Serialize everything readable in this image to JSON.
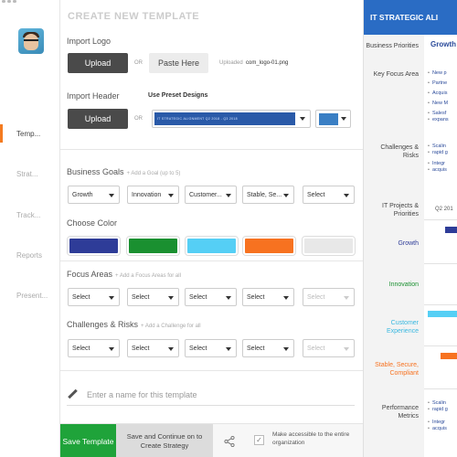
{
  "sidebar": {
    "items": [
      {
        "label": "Temp..."
      },
      {
        "label": "Strat..."
      },
      {
        "label": "Track..."
      },
      {
        "label": "Reports"
      },
      {
        "label": "Present..."
      }
    ]
  },
  "panel": {
    "title": "CREATE NEW TEMPLATE",
    "import_logo": {
      "label": "Import Logo",
      "upload": "Upload",
      "or": "OR",
      "paste": "Paste Here",
      "uploaded_label": "Uploaded",
      "uploaded_file": "com_logo-01.png"
    },
    "import_header": {
      "label": "Import Header",
      "upload": "Upload",
      "or": "OR",
      "preset_label": "Use Preset Designs",
      "preset_strip_text": "IT STRATEGIC ALIGNMENT   Q2 2018 - Q3 2018",
      "color_value": "#3a7fc4"
    },
    "business_goals": {
      "label": "Business Goals",
      "hint": "+ Add a Goal (up to 5)",
      "selects": [
        "Growth",
        "Innovation",
        "Customer...",
        "Stable, Se...",
        "Select"
      ]
    },
    "choose_color": {
      "label": "Choose Color",
      "colors": [
        "#2e3c98",
        "#1a9030",
        "#55cff5",
        "#f77220",
        "#e8e8e8"
      ]
    },
    "focus_areas": {
      "label": "Focus Areas",
      "hint": "+ Add a Focus Areas for all",
      "selects": [
        "Select",
        "Select",
        "Select",
        "Select",
        "Select"
      ]
    },
    "challenges": {
      "label": "Challenges & Risks",
      "hint": "+ Add a Challenge for all",
      "selects": [
        "Select",
        "Select",
        "Select",
        "Select",
        "Select"
      ]
    },
    "name_placeholder": "Enter a name for this template",
    "footer": {
      "save": "Save Template",
      "continue": "Save and Continue on to Create Strategy",
      "access": "Make accessible to the entire organization",
      "check": "✓"
    }
  },
  "preview": {
    "header": "IT STRATEGIC ALI",
    "rows": [
      "Business Priorities",
      "Key Focus Area",
      "Challenges & Risks",
      "IT Projects & Priorities",
      "Growth",
      "Innovation",
      "Customer Experience",
      "Stable, Secure, Compliant",
      "Performance Metrics"
    ],
    "growth_title": "Growth",
    "focus_bullets": [
      "New p",
      "Partne",
      "Acquis",
      "New M",
      "Salesf",
      "expans"
    ],
    "challenge_bullets": [
      "Scalin",
      "rapid g",
      "Integr",
      "acquis"
    ],
    "quarter": "Q2 201",
    "metric_bullets": [
      "Scalin",
      "rapid g",
      "Integr",
      "acquis"
    ]
  }
}
